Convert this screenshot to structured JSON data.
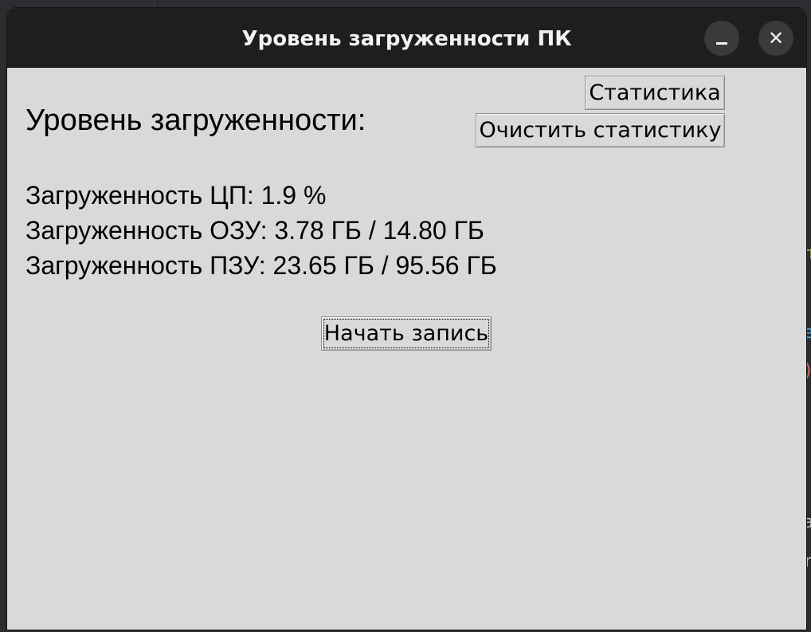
{
  "window": {
    "title": "Уровень загруженности ПК",
    "minimize_label": "–",
    "close_label": "✕"
  },
  "main": {
    "heading": "Уровень загруженности:",
    "cpu_text": "Загруженность ЦП: 1.9 %",
    "ram_text": "Загруженность ОЗУ: 3.78 ГБ / 14.80 ГБ",
    "rom_text": "Загруженность ПЗУ: 23.65 ГБ / 95.56 ГБ"
  },
  "buttons": {
    "statistics": "Статистика",
    "clear_statistics": "Очистить статистику",
    "start_recording": "Начать запись"
  },
  "icons": {
    "minimize": "minimize-icon",
    "close": "close-icon"
  },
  "colors": {
    "titlebar": "#1e1e1e",
    "window_bg": "#d9d9d9",
    "desktop_bg": "#2b2d31"
  }
}
